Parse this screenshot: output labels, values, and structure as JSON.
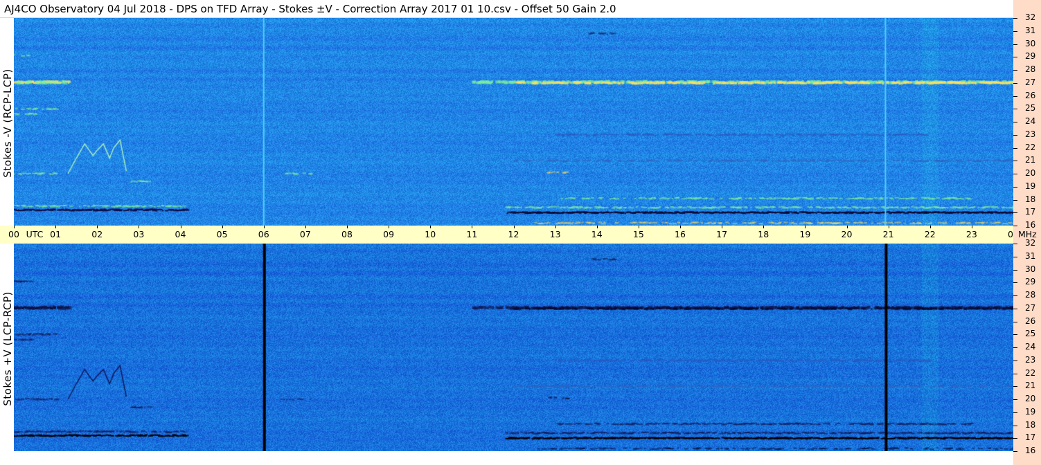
{
  "header": {
    "title": "AJ4CO Observatory  04 Jul 2018  -  DPS on TFD Array  -  Stokes ±V  -  Correction Array 2017 01 10.csv  -  Offset 50  Gain 2.0"
  },
  "panels": {
    "top_ylabel": "Stokes -V (RCP-LCP)",
    "bottom_ylabel": "Stokes +V (LCP-RCP)"
  },
  "time_axis": {
    "ticks": [
      "00",
      "UTC",
      "01",
      "02",
      "03",
      "04",
      "05",
      "06",
      "07",
      "08",
      "09",
      "10",
      "11",
      "12",
      "13",
      "14",
      "15",
      "16",
      "17",
      "18",
      "19",
      "20",
      "21",
      "22",
      "23",
      "00"
    ],
    "unit_label": "MHz"
  },
  "freq_axis": {
    "labels": [
      "32",
      "31",
      "30",
      "29",
      "28",
      "27",
      "26",
      "25",
      "24",
      "23",
      "22",
      "21",
      "20",
      "19",
      "18",
      "17",
      "16"
    ]
  },
  "colors": {
    "background": "#1a6ee6",
    "time_axis_bg": "#ffffc6",
    "freq_axis_bg": "#ffdcc8"
  },
  "chart_data": {
    "type": "heatmap",
    "title": "AJ4CO Observatory  04 Jul 2018  -  DPS on TFD Array  -  Stokes ±V  -  Correction Array 2017 01 10.csv  -  Offset 50  Gain 2.0",
    "xlabel": "UTC",
    "ylabel_top": "Stokes -V (RCP-LCP)",
    "ylabel_bottom": "Stokes +V (LCP-RCP)",
    "x_unit": "hour UTC",
    "y_unit": "MHz",
    "xlim": [
      0,
      24
    ],
    "ylim": [
      16,
      32
    ],
    "x_ticks": [
      0,
      1,
      2,
      3,
      4,
      5,
      6,
      7,
      8,
      9,
      10,
      11,
      12,
      13,
      14,
      15,
      16,
      17,
      18,
      19,
      20,
      21,
      22,
      23,
      24
    ],
    "y_ticks": [
      16,
      17,
      18,
      19,
      20,
      21,
      22,
      23,
      24,
      25,
      26,
      27,
      28,
      29,
      30,
      31,
      32
    ],
    "features": [
      {
        "name": "27 MHz band",
        "freq": 27,
        "start_hour": 0,
        "end_hour": 24
      },
      {
        "name": "17 MHz band",
        "freq": 17,
        "start_hour": 11.8,
        "end_hour": 24
      },
      {
        "name": "burst",
        "start_hour": 1.3,
        "end_hour": 2.7,
        "freq_low": 20,
        "freq_high": 22.5
      },
      {
        "name": "vertical line",
        "hour": 6.0
      },
      {
        "name": "vertical line",
        "hour": 20.93
      }
    ]
  }
}
